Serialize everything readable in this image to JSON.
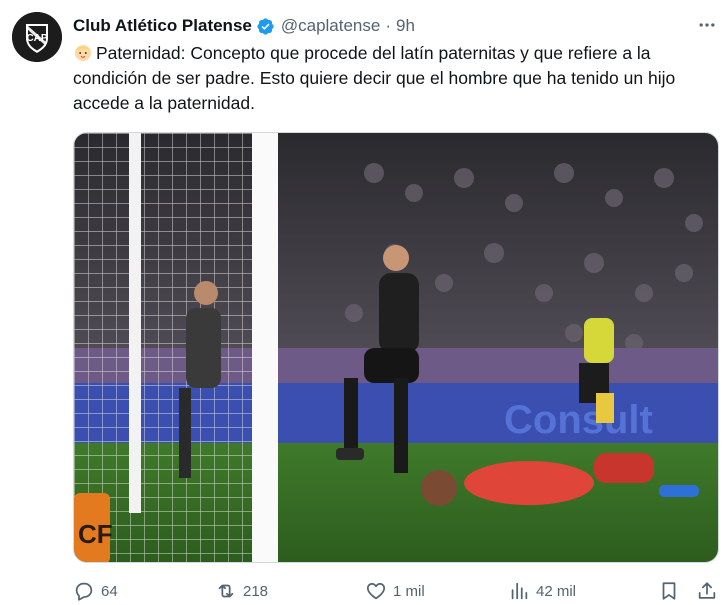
{
  "post": {
    "author_name": "Club Atlético Platense",
    "handle": "@caplatense",
    "separator": "·",
    "time": "9h",
    "avatar_text": "CAP",
    "text": "Paternidad: Concepto que procede del latín paternitas y que refiere a la condición de ser padre. Esto quiere decir que el hombre que ha tenido un hijo accede a la paternidad."
  },
  "media": {
    "board_text": "Consult",
    "sign_text": "CF"
  },
  "actions": {
    "replies": "64",
    "reposts": "218",
    "likes": "1 mil",
    "views": "42 mil"
  },
  "icons": {
    "verified": "verified-badge-icon",
    "more": "more-icon",
    "reply": "reply-icon",
    "repost": "repost-icon",
    "like": "heart-icon",
    "views": "views-icon",
    "bookmark": "bookmark-icon",
    "share": "share-icon"
  },
  "colors": {
    "verified_blue": "#1d9bf0",
    "text_primary": "#0f1419",
    "text_secondary": "#536471"
  }
}
